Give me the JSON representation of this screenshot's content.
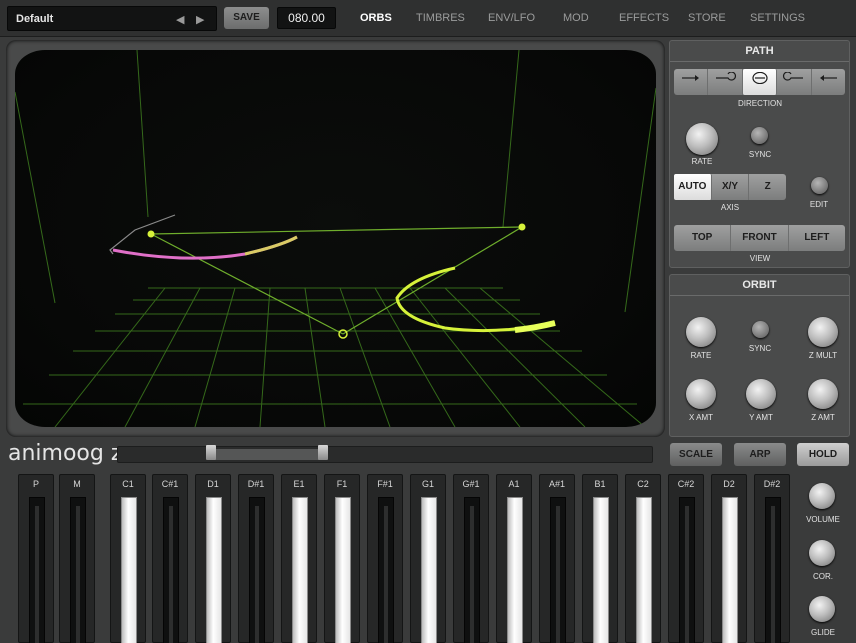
{
  "topbar": {
    "preset_name": "Default",
    "prev_icon": "◀",
    "next_icon": "▶",
    "save_label": "SAVE",
    "bpm": "080.00",
    "tabs": [
      {
        "label": "ORBS",
        "active": true
      },
      {
        "label": "TIMBRES",
        "active": false
      },
      {
        "label": "ENV/LFO",
        "active": false
      },
      {
        "label": "MOD",
        "active": false
      },
      {
        "label": "EFFECTS",
        "active": false
      },
      {
        "label": "STORE",
        "active": false
      },
      {
        "label": "SETTINGS",
        "active": false
      }
    ]
  },
  "path": {
    "title": "PATH",
    "direction_label": "DIRECTION",
    "direction_icons": [
      "arrow-right-icon",
      "loop-right-icon",
      "loop-both-icon",
      "loop-left-icon",
      "arrow-left-icon"
    ],
    "direction_selected": 2,
    "rate_label": "RATE",
    "sync_label": "SYNC",
    "axis_options": [
      "AUTO",
      "X/Y",
      "Z"
    ],
    "axis_selected": 0,
    "axis_label": "AXIS",
    "edit_label": "EDIT",
    "view_options": [
      "TOP",
      "FRONT",
      "LEFT"
    ],
    "view_label": "VIEW"
  },
  "orbit": {
    "title": "ORBIT",
    "rate_label": "RATE",
    "sync_label": "SYNC",
    "zmult_label": "Z MULT",
    "xamt_label": "X AMT",
    "yamt_label": "Y AMT",
    "zamt_label": "Z AMT"
  },
  "bottom": {
    "logo": "animoog z",
    "scale_label": "SCALE",
    "arp_label": "ARP",
    "hold_label": "HOLD",
    "keys": [
      {
        "label": "P",
        "white": false
      },
      {
        "label": "M",
        "white": false
      },
      {
        "label": "C1",
        "white": true
      },
      {
        "label": "C#1",
        "white": false
      },
      {
        "label": "D1",
        "white": true
      },
      {
        "label": "D#1",
        "white": false
      },
      {
        "label": "E1",
        "white": true
      },
      {
        "label": "F1",
        "white": true
      },
      {
        "label": "F#1",
        "white": false
      },
      {
        "label": "G1",
        "white": true
      },
      {
        "label": "G#1",
        "white": false
      },
      {
        "label": "A1",
        "white": true
      },
      {
        "label": "A#1",
        "white": false
      },
      {
        "label": "B1",
        "white": true
      },
      {
        "label": "C2",
        "white": true
      },
      {
        "label": "C#2",
        "white": false
      },
      {
        "label": "D2",
        "white": true
      },
      {
        "label": "D#2",
        "white": false
      }
    ],
    "volume_label": "VOLUME",
    "cor_label": "COR.",
    "glide_label": "GLIDE"
  },
  "colors": {
    "grid_green": "#3d7a1e",
    "orb_yellow": "#d6f23a",
    "orb_pink": "#e070c8"
  }
}
